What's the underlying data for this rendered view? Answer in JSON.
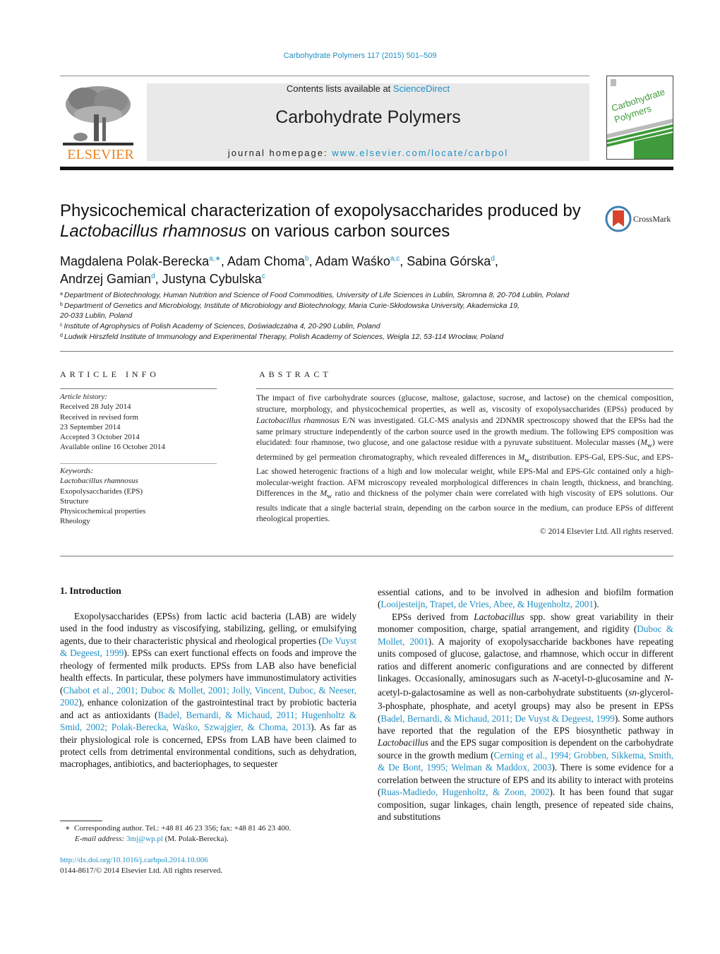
{
  "running_header": "Carbohydrate Polymers 117 (2015) 501–509",
  "masthead": {
    "publisher_logo": "ELSEVIER",
    "contents_prefix": "Contents lists available at ",
    "contents_link": "ScienceDirect",
    "journal_title": "Carbohydrate Polymers",
    "homepage_prefix": "journal homepage: ",
    "homepage_link": "www.elsevier.com/locate/carbpol",
    "cover_title_line1": "Carbohydrate",
    "cover_title_line2": "Polymers",
    "cover_accent": "#3e9a3a"
  },
  "article": {
    "title_line1": "Physicochemical characterization of exopolysaccharides produced by",
    "title_italic": "Lactobacillus rhamnosus",
    "title_rest": " on various carbon sources",
    "crossmark_label": "CrossMark",
    "authors": [
      {
        "name": "Magdalena Polak-Berecka",
        "sup": "a,∗",
        "sep": ", "
      },
      {
        "name": "Adam Choma",
        "sup": "b",
        "sep": ", "
      },
      {
        "name": "Adam Waśko",
        "sup": "a,c",
        "sep": ", "
      },
      {
        "name": "Sabina Górska",
        "sup": "d",
        "sep": ","
      },
      {
        "name": "Andrzej Gamian",
        "sup": "d",
        "sep": ", "
      },
      {
        "name": "Justyna Cybulska",
        "sup": "c",
        "sep": ""
      }
    ],
    "affiliations": [
      {
        "key": "a",
        "text": "Department of Biotechnology, Human Nutrition and Science of Food Commodities, University of Life Sciences in Lublin, Skromna 8, 20-704 Lublin, Poland"
      },
      {
        "key": "b",
        "text": "Department of Genetics and Microbiology, Institute of Microbiology and Biotechnology, Maria Curie-Skłodowska University, Akademicka 19,"
      },
      {
        "key": "",
        "text": "20-033 Lublin, Poland"
      },
      {
        "key": "c",
        "text": "Institute of Agrophysics of Polish Academy of Sciences, Doświadczalna 4, 20-290 Lublin, Poland"
      },
      {
        "key": "d",
        "text": "Ludwik Hirszfeld Institute of Immunology and Experimental Therapy, Polish Academy of Sciences, Weigla 12, 53-114 Wrocław, Poland"
      }
    ]
  },
  "article_info": {
    "caption": "ARTICLE INFO",
    "history_label": "Article history:",
    "history": [
      "Received 28 July 2014",
      "Received in revised form",
      "23 September 2014",
      "Accepted 3 October 2014",
      "Available online 16 October 2014"
    ],
    "keywords_label": "Keywords:",
    "keywords": [
      "Lactobacillus rhamnosus",
      "Exopolysaccharides (EPS)",
      "Structure",
      "Physicochemical properties",
      "Rheology"
    ]
  },
  "abstract": {
    "caption": "ABSTRACT",
    "p1": "The impact of five carbohydrate sources (glucose, maltose, galactose, sucrose, and lactose) on the chemical composition, structure, morphology, and physicochemical properties, as well as, viscosity of exopolysaccharides (EPSs) produced by ",
    "p1_italic": "Lactobacillus rhamnosus",
    "p2": " E/N was investigated. GLC-MS analysis and 2DNMR spectroscopy showed that the EPSs had the same primary structure independently of the carbon source used in the growth medium. The following EPS composition was elucidated: four rhamnose, two glucose, and one galactose residue with a pyruvate substituent. Molecular masses (",
    "mw": "M",
    "mw_sub": "w",
    "p3": ") were determined by gel permeation chromatography, which revealed differences in ",
    "p4": " distribution. EPS-Gal, EPS-Suc, and EPS-Lac showed heterogenic fractions of a high and low molecular weight, while EPS-Mal and EPS-Glc contained only a high-molecular-weight fraction. AFM microscopy revealed morphological differences in chain length, thickness, and branching. Differences in the ",
    "p5": " ratio and thickness of the polymer chain were correlated with high viscosity of EPS solutions. Our results indicate that a single bacterial strain, depending on the carbon source in the medium, can produce EPSs of different rheological properties.",
    "copyright": "© 2014 Elsevier Ltd. All rights reserved."
  },
  "body": {
    "section_heading": "1.  Introduction",
    "left": {
      "t1": "Exopolysaccharides (EPSs) from lactic acid bacteria (LAB) are widely used in the food industry as viscosifying, stabilizing, gelling, or emulsifying agents, due to their characteristic physical and rheological properties (",
      "c1": "De Vuyst & Degeest, 1999",
      "t2": "). EPSs can exert functional effects on foods and improve the rheology of fermented milk products. EPSs from LAB also have beneficial health effects. In particular, these polymers have immunostimulatory activities (",
      "c2": "Chabot et al., 2001; Duboc & Mollet, 2001; Jolly, Vincent, Duboc, & Neeser, 2002",
      "t3": "), enhance colonization of the gastrointestinal tract by probiotic bacteria and act as antioxidants (",
      "c3": "Badel, Bernardi, & Michaud, 2011; Hugenholtz & Smid, 2002; Polak-Berecka, Waśko, Szwajgier, & Choma, 2013",
      "t4": "). As far as their physiological role is concerned, EPSs from LAB have been claimed to protect cells from detrimental environmental conditions, such as dehydration, macrophages, antibiotics, and bacteriophages, to sequester"
    },
    "right": {
      "t1": "essential cations, and to be involved in adhesion and biofilm formation (",
      "c1": "Looijesteijn, Trapet, de Vries, Abee, & Hugenholtz, 2001",
      "t2": ").",
      "p2_t1": "EPSs derived from ",
      "p2_i1": "Lactobacillus",
      "p2_t2": " spp. show great variability in their monomer composition, charge, spatial arrangement, and rigidity (",
      "p2_c1": "Duboc & Mollet, 2001",
      "p2_t3": "). A majority of exopolysaccharide backbones have repeating units composed of glucose, galactose, and rhamnose, which occur in different ratios and different anomeric configurations and are connected by different linkages. Occasionally, aminosugars such as ",
      "p2_i2": "N",
      "p2_t4": "-acetyl-",
      "p2_sc1": "D",
      "p2_t5": "-glucosamine and ",
      "p2_i3": "N",
      "p2_t6": "-acetyl-",
      "p2_sc2": "D",
      "p2_t7": "-galactosamine as well as non-carbohydrate substituents (",
      "p2_i4": "sn",
      "p2_t8": "-glycerol-3-phosphate, phosphate, and acetyl groups) may also be present in EPSs (",
      "p2_c2": "Badel, Bernardi, & Michaud, 2011; De Vuyst & Degeest, 1999",
      "p2_t9": "). Some authors have reported that the regulation of the EPS biosynthetic pathway in ",
      "p2_i5": "Lactobacillus",
      "p2_t10": " and the EPS sugar composition is dependent on the carbohydrate source in the growth medium (",
      "p2_c3": "Cerning et al., 1994; Grobben, Sikkema, Smith, & De Bont, 1995; Welman & Maddox, 2003",
      "p2_t11": "). There is some evidence for a correlation between the structure of EPS and its ability to interact with proteins (",
      "p2_c4": "Ruas-Madiedo, Hugenholtz, & Zoon, 2002",
      "p2_t12": "). It has been found that sugar composition, sugar linkages, chain length, presence of repeated side chains, and substitutions"
    }
  },
  "footnote": {
    "marker": "∗",
    "line1": "Corresponding author. Tel.: +48 81 46 23 356; fax: +48 81 46 23 400.",
    "email_label": "E-mail address: ",
    "email": "3mj@wp.pl",
    "email_suffix": " (M. Polak-Berecka)."
  },
  "doi": {
    "link": "http://dx.doi.org/10.1016/j.carbpol.2014.10.006",
    "issn": "0144-8617/© 2014 Elsevier Ltd. All rights reserved."
  }
}
